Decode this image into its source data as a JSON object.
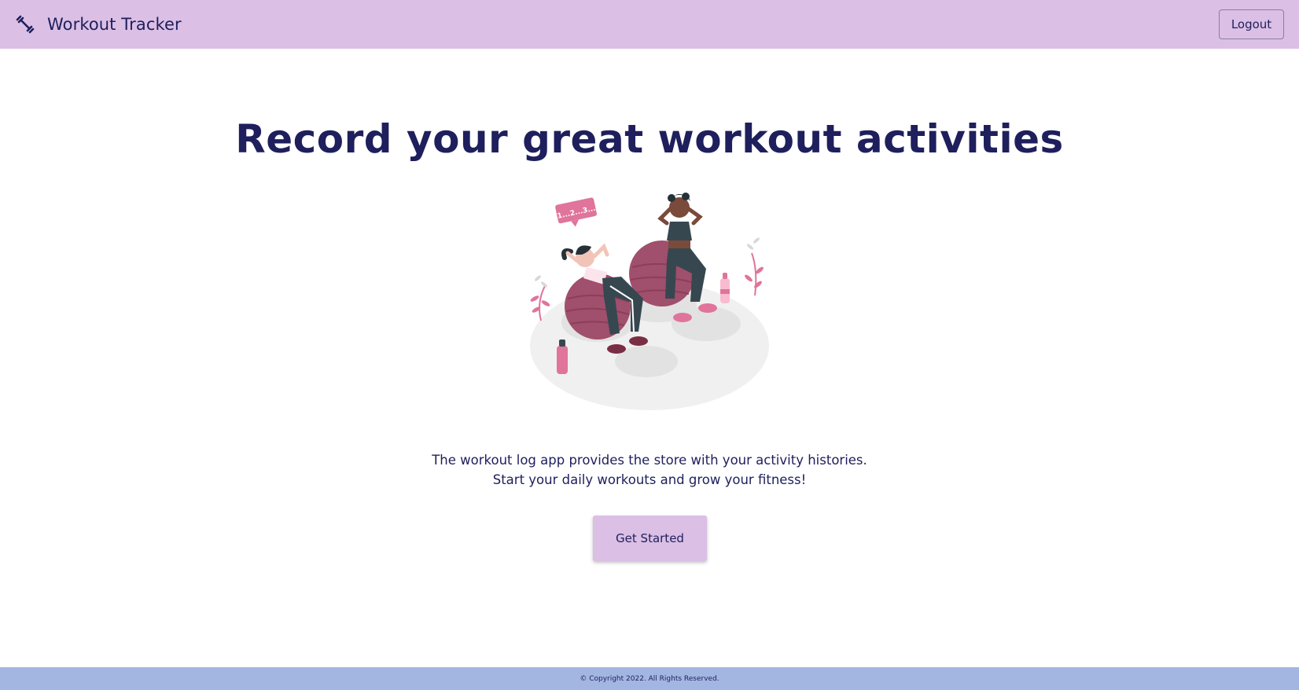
{
  "navbar": {
    "brand_icon": "dumbbell-icon",
    "brand_name": "Workout Tracker",
    "logout_label": "Logout"
  },
  "hero": {
    "title": "Record your great workout activities",
    "illustration": "women-exercising-on-fitness-balls",
    "counter_bubble": "1...2...3...",
    "description_line1": "The workout log app provides the store with your activity histories.",
    "description_line2": "Start your daily workouts and grow your fitness!",
    "cta_label": "Get Started"
  },
  "footer": {
    "copyright": "© Copyright 2022. All Rights Reserved."
  },
  "colors": {
    "navbar_bg": "#dbbfe5",
    "footer_bg": "#a3b6e1",
    "text": "#1e1f5c",
    "accent_pink": "#e0749b",
    "ball": "#a04f6c"
  }
}
